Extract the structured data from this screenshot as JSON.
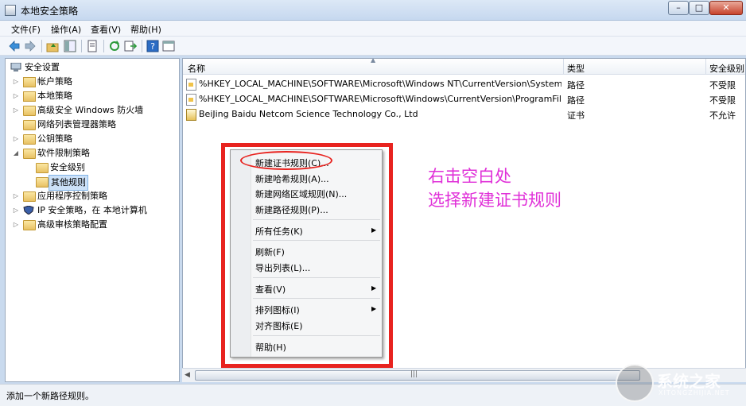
{
  "window": {
    "title": "本地安全策略",
    "controls": {
      "minimize": "–",
      "maximize": "□",
      "close": "✕"
    }
  },
  "menu": [
    "文件(F)",
    "操作(A)",
    "查看(V)",
    "帮助(H)"
  ],
  "toolbar": {
    "icons": [
      "back-arrow-icon",
      "forward-arrow-icon",
      "up-folder-icon",
      "show-tree-icon",
      "properties-icon",
      "refresh-icon",
      "export-list-icon",
      "help-icon",
      "console-icon"
    ]
  },
  "tree": {
    "root": "安全设置",
    "items": [
      {
        "label": "帐户策略"
      },
      {
        "label": "本地策略"
      },
      {
        "label": "高级安全 Windows 防火墙"
      },
      {
        "label": "网络列表管理器策略"
      },
      {
        "label": "公钥策略"
      },
      {
        "label": "软件限制策略"
      },
      {
        "label": "安全级别"
      },
      {
        "label": "其他规则"
      },
      {
        "label": "应用程序控制策略"
      },
      {
        "label": "IP 安全策略，在 本地计算机"
      },
      {
        "label": "高级审核策略配置"
      }
    ]
  },
  "list": {
    "columns": [
      "名称",
      "类型",
      "安全级别"
    ],
    "rows": [
      {
        "name": "%HKEY_LOCAL_MACHINE\\SOFTWARE\\Microsoft\\Windows NT\\CurrentVersion\\System...",
        "type": "路径",
        "level": "不受限"
      },
      {
        "name": "%HKEY_LOCAL_MACHINE\\SOFTWARE\\Microsoft\\Windows\\CurrentVersion\\ProgramFil...",
        "type": "路径",
        "level": "不受限"
      },
      {
        "name": "BeiJing Baidu Netcom Science Technology Co., Ltd",
        "type": "证书",
        "level": "不允许"
      }
    ]
  },
  "context_menu": {
    "items": [
      {
        "label": "新建证书规则(C)..."
      },
      {
        "label": "新建哈希规则(A)..."
      },
      {
        "label": "新建网络区域规则(N)..."
      },
      {
        "label": "新建路径规则(P)..."
      },
      {
        "label": "所有任务(K)"
      },
      {
        "label": "刷新(F)"
      },
      {
        "label": "导出列表(L)..."
      },
      {
        "label": "查看(V)"
      },
      {
        "label": "排列图标(I)"
      },
      {
        "label": "对齐图标(E)"
      },
      {
        "label": "帮助(H)"
      }
    ]
  },
  "annotation": {
    "line1": "右击空白处",
    "line2": "选择新建证书规则"
  },
  "status": "添加一个新路径规则。",
  "scrollbar": {
    "grip": "|||"
  },
  "watermark": {
    "text": "系统之家",
    "sub": "XITONGZHIJIA.NET"
  },
  "colors": {
    "highlight_red": "#e8231f",
    "annotation_magenta": "#e030d8",
    "selection_blue": "#cce1f8"
  }
}
